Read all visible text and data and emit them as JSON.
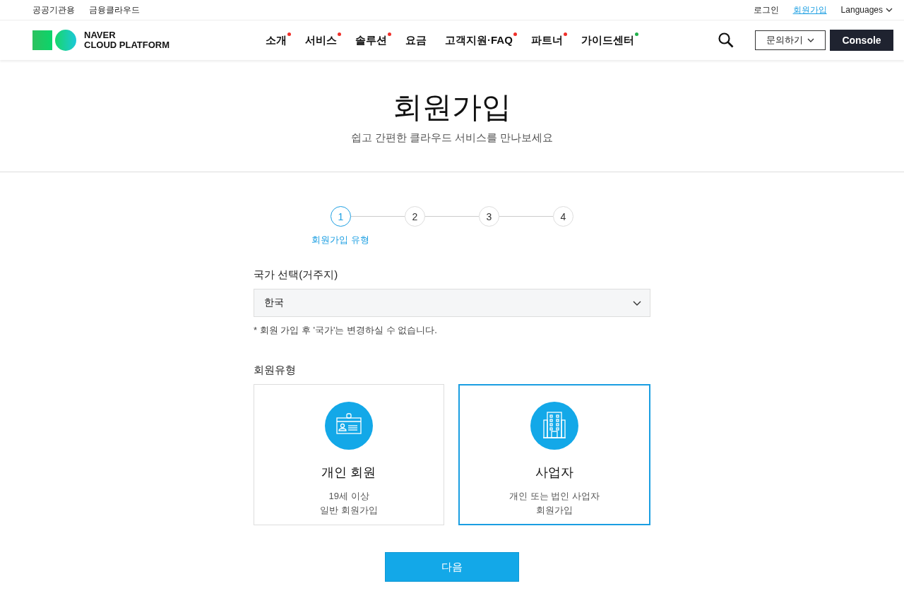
{
  "top_bar": {
    "left_links": [
      "공공기관용",
      "금융클라우드"
    ],
    "right_links": [
      {
        "label": "로그인",
        "selected": false
      },
      {
        "label": "회원가입",
        "selected": true
      }
    ],
    "language": "Languages"
  },
  "header": {
    "logo_line1": "NAVER",
    "logo_line2": "CLOUD PLATFORM",
    "nav": [
      {
        "label": "소개",
        "color": "#f0302a"
      },
      {
        "label": "서비스",
        "color": "#f0302a"
      },
      {
        "label": "솔루션",
        "color": "#f0302a"
      },
      {
        "label": "요금"
      },
      {
        "label": "고객지원·FAQ",
        "color": "#f0302a"
      },
      {
        "label": "파트너",
        "color": "#f0302a"
      },
      {
        "label": "가이드센터",
        "color": "#22b04b"
      }
    ],
    "contact_button": "문의하기",
    "console_button": "Console"
  },
  "hero": {
    "title": "회원가입",
    "subtitle": "쉽고 간편한 클라우드 서비스를 만나보세요"
  },
  "steps": [
    {
      "number": "1",
      "label": "회원가입 유형",
      "selected": true
    },
    {
      "number": "2",
      "selected": false
    },
    {
      "number": "3",
      "selected": false
    },
    {
      "number": "4",
      "selected": false
    }
  ],
  "country": {
    "label": "국가 선택(거주지)",
    "value": "한국",
    "note": "* 회원 가입 후 '국가'는 변경하실 수 없습니다."
  },
  "member_type": {
    "label": "회원유형",
    "options": [
      {
        "kind": "person",
        "title": "개인 회원",
        "lines": [
          "19세 이상",
          "일반 회원가입"
        ],
        "selected": false
      },
      {
        "kind": "business",
        "title": "사업자",
        "lines": [
          "개인 또는 법인 사업자",
          "회원가입"
        ],
        "selected": true
      }
    ]
  },
  "next_button": "다음"
}
